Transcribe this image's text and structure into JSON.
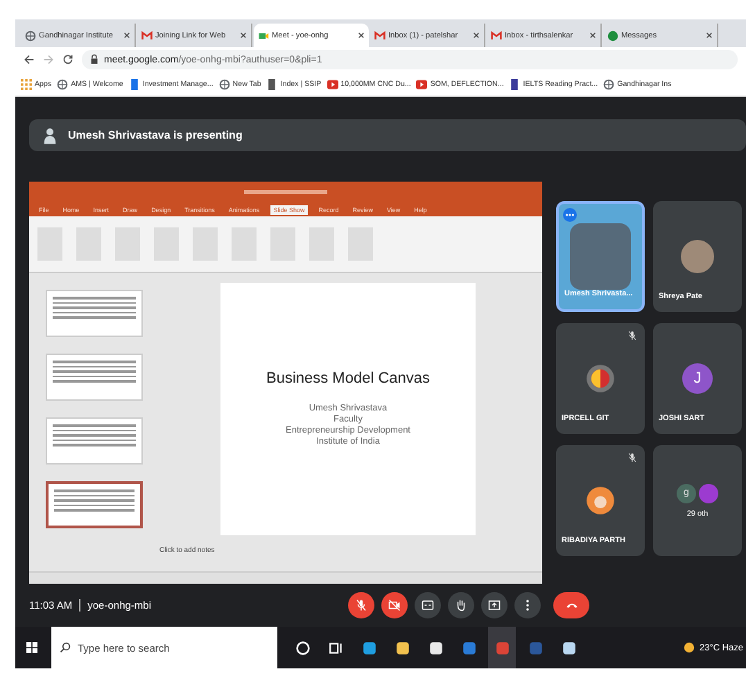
{
  "browser": {
    "tabs": [
      {
        "title": "Gandhinagar Institute",
        "kind": "globe",
        "selected": false
      },
      {
        "title": "Joining Link for Web",
        "kind": "mail",
        "selected": false
      },
      {
        "title": "Meet - yoe-onhg",
        "kind": "meet",
        "selected": true
      },
      {
        "title": "Inbox (1) - patelshar",
        "kind": "mail",
        "selected": false
      },
      {
        "title": "Inbox - tirthsalenkar",
        "kind": "mail",
        "selected": false
      },
      {
        "title": "Messages",
        "kind": "messages",
        "selected": false
      }
    ],
    "url_host": "meet.google.com",
    "url_path": "/yoe-onhg-mbi?authuser=0&pli=1",
    "bookmarks": [
      {
        "label": "Apps",
        "kind": "apps"
      },
      {
        "label": "AMS | Welcome",
        "kind": "globe"
      },
      {
        "label": "Investment Manage...",
        "kind": "doc"
      },
      {
        "label": "New Tab",
        "kind": "globe"
      },
      {
        "label": "Index | SSIP",
        "kind": "pin"
      },
      {
        "label": "10,000MM CNC Du...",
        "kind": "video"
      },
      {
        "label": "SOM, DEFLECTION...",
        "kind": "video"
      },
      {
        "label": "IELTS Reading Pract...",
        "kind": "book"
      },
      {
        "label": "Gandhinagar Ins",
        "kind": "globe"
      }
    ]
  },
  "banner": {
    "text": "Umesh Shrivastava is presenting"
  },
  "presentation": {
    "ribbon_tabs": [
      {
        "label": "File",
        "selected": false
      },
      {
        "label": "Home",
        "selected": false
      },
      {
        "label": "Insert",
        "selected": false
      },
      {
        "label": "Draw",
        "selected": false
      },
      {
        "label": "Design",
        "selected": false
      },
      {
        "label": "Transitions",
        "selected": false
      },
      {
        "label": "Animations",
        "selected": false
      },
      {
        "label": "Slide Show",
        "selected": true
      },
      {
        "label": "Record",
        "selected": false
      },
      {
        "label": "Review",
        "selected": false
      },
      {
        "label": "View",
        "selected": false
      },
      {
        "label": "Help",
        "selected": false
      }
    ],
    "thumbnails": [
      {
        "selected": false
      },
      {
        "selected": false
      },
      {
        "selected": false
      },
      {
        "selected": true
      }
    ],
    "slide": {
      "title": "Business Model Canvas",
      "lines": [
        "Umesh Shrivastava",
        "Faculty",
        "Entrepreneurship Development",
        "Institute of India"
      ]
    },
    "notes_placeholder": "Click to add notes"
  },
  "participants": [
    {
      "name": "Umesh Shrivasta...",
      "kind": "photo",
      "speaking": true,
      "muted": false
    },
    {
      "name": "Shreya Pate",
      "kind": "photo",
      "speaking": false,
      "muted": false
    },
    {
      "name": "IPRCELL GIT",
      "kind": "logo",
      "speaking": false,
      "muted": true
    },
    {
      "name": "JOSHI SART",
      "kind": "letter",
      "initial": "J",
      "speaking": false,
      "muted": false
    },
    {
      "name": "RIBADIYA PARTH",
      "kind": "drawing",
      "speaking": false,
      "muted": true
    },
    {
      "name": "29 oth",
      "kind": "group",
      "initial": "g",
      "speaking": false,
      "muted": false
    }
  ],
  "meeting": {
    "time": "11:03 AM",
    "code": "yoe-onhg-mbi"
  },
  "controls": [
    {
      "kind": "mic",
      "off": true
    },
    {
      "kind": "camera",
      "off": true
    },
    {
      "kind": "captions",
      "off": false
    },
    {
      "kind": "hand",
      "off": false
    },
    {
      "kind": "present",
      "off": false
    },
    {
      "kind": "more",
      "off": false
    },
    {
      "kind": "leave",
      "off": false
    }
  ],
  "taskbar": {
    "search_placeholder": "Type here to search",
    "apps": [
      {
        "kind": "cortana",
        "selected": false
      },
      {
        "kind": "taskview",
        "selected": false
      },
      {
        "kind": "edge",
        "selected": false
      },
      {
        "kind": "folder",
        "selected": false
      },
      {
        "kind": "notepad",
        "selected": false
      },
      {
        "kind": "mail",
        "selected": false
      },
      {
        "kind": "chrome",
        "selected": true
      },
      {
        "kind": "word",
        "selected": false
      },
      {
        "kind": "paint",
        "selected": false
      }
    ],
    "weather": "23°C Haze"
  }
}
